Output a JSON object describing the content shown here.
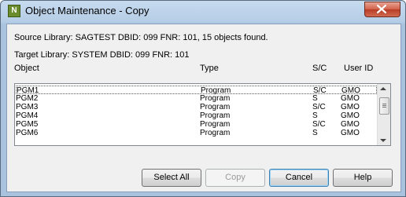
{
  "window": {
    "title": "Object Maintenance - Copy",
    "icon_letter": "N"
  },
  "source_info": "Source Library: SAGTEST  DBID: 099  FNR: 101, 15 objects found.",
  "target_info": "Target Library: SYSTEM   DBID: 099  FNR: 101",
  "columns": {
    "object": "Object",
    "type": "Type",
    "sc": "S/C",
    "user": "User ID"
  },
  "rows": [
    {
      "object": "PGM1",
      "type": "Program",
      "sc": "S/C",
      "user": "GMO"
    },
    {
      "object": "PGM2",
      "type": "Program",
      "sc": "S",
      "user": "GMO"
    },
    {
      "object": "PGM3",
      "type": "Program",
      "sc": "S/C",
      "user": "GMO"
    },
    {
      "object": "PGM4",
      "type": "Program",
      "sc": "S",
      "user": "GMO"
    },
    {
      "object": "PGM5",
      "type": "Program",
      "sc": "S/C",
      "user": "GMO"
    },
    {
      "object": "PGM6",
      "type": "Program",
      "sc": "S",
      "user": "GMO"
    }
  ],
  "buttons": {
    "select_all": "Select All",
    "copy": "Copy",
    "cancel": "Cancel",
    "help": "Help"
  },
  "icons": {
    "close": "close-icon",
    "scroll_up": "chevron-up-icon",
    "scroll_down": "chevron-down-icon"
  }
}
